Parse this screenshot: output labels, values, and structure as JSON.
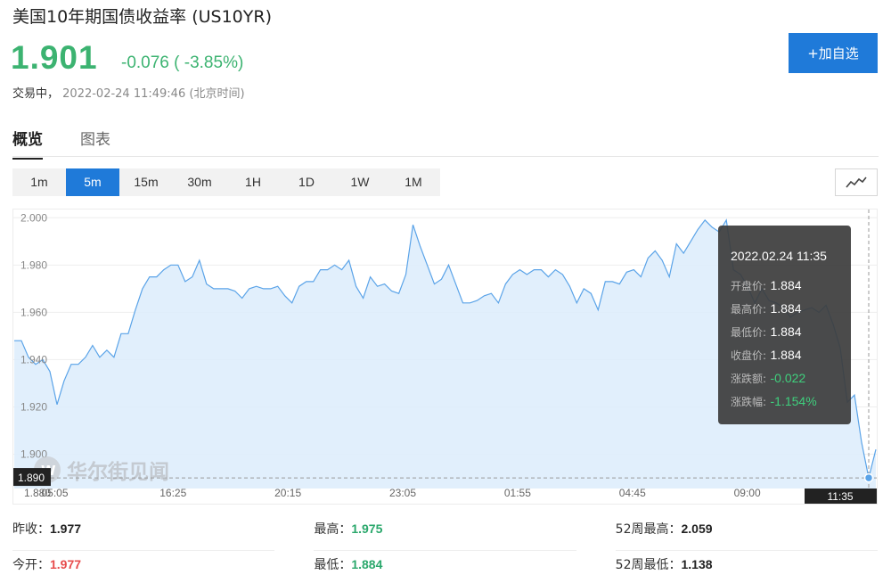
{
  "header": {
    "title": "美国10年期国债收益率 (US10YR)",
    "price": "1.901",
    "change": "-0.076 ( -3.85%)",
    "status": "交易中，",
    "datetime": "2022-02-24 11:49:46",
    "timezone": "(北京时间)",
    "add_button": "+加自选"
  },
  "tabs": [
    {
      "label": "概览",
      "active": true
    },
    {
      "label": "图表",
      "active": false
    }
  ],
  "periods": [
    {
      "label": "1m",
      "active": false
    },
    {
      "label": "5m",
      "active": true
    },
    {
      "label": "15m",
      "active": false
    },
    {
      "label": "30m",
      "active": false
    },
    {
      "label": "1H",
      "active": false
    },
    {
      "label": "1D",
      "active": false
    },
    {
      "label": "1W",
      "active": false
    },
    {
      "label": "1M",
      "active": false
    }
  ],
  "chart_type_icon": "line-chart-icon",
  "chart_data": {
    "type": "area",
    "y_ticks": [
      "2.000",
      "1.980",
      "1.960",
      "1.940",
      "1.920",
      "1.900"
    ],
    "ylim": [
      1.8855,
      2.0035
    ],
    "x_ticks": [
      "05:05",
      "16:25",
      "20:15",
      "23:05",
      "01:55",
      "04:45",
      "09:00"
    ],
    "x_tick_positions": [
      0.048,
      0.185,
      0.318,
      0.451,
      0.584,
      0.717,
      0.85
    ],
    "crosshair_price": "1.890",
    "crosshair_time": "11:35",
    "bottom_left_label": "1.880",
    "values": [
      1.948,
      1.948,
      1.941,
      1.938,
      1.94,
      1.935,
      1.921,
      1.931,
      1.938,
      1.938,
      1.941,
      1.946,
      1.941,
      1.944,
      1.941,
      1.951,
      1.951,
      1.961,
      1.97,
      1.975,
      1.975,
      1.978,
      1.98,
      1.98,
      1.973,
      1.975,
      1.982,
      1.972,
      1.97,
      1.97,
      1.97,
      1.969,
      1.966,
      1.97,
      1.971,
      1.97,
      1.97,
      1.971,
      1.967,
      1.964,
      1.971,
      1.973,
      1.973,
      1.978,
      1.978,
      1.98,
      1.978,
      1.982,
      1.971,
      1.966,
      1.975,
      1.971,
      1.972,
      1.969,
      1.968,
      1.976,
      1.997,
      1.988,
      1.98,
      1.972,
      1.974,
      1.98,
      1.972,
      1.964,
      1.964,
      1.965,
      1.967,
      1.968,
      1.964,
      1.972,
      1.976,
      1.978,
      1.976,
      1.978,
      1.978,
      1.975,
      1.978,
      1.976,
      1.971,
      1.964,
      1.97,
      1.968,
      1.961,
      1.973,
      1.973,
      1.972,
      1.977,
      1.978,
      1.975,
      1.983,
      1.986,
      1.982,
      1.975,
      1.989,
      1.985,
      1.99,
      1.995,
      1.999,
      1.996,
      1.994,
      1.999,
      1.978,
      1.976,
      1.971,
      1.964,
      1.97,
      1.965,
      1.964,
      1.962,
      1.958,
      1.96,
      1.961,
      1.962,
      1.96,
      1.963,
      1.955,
      1.945,
      1.922,
      1.925,
      1.905,
      1.89,
      1.902
    ]
  },
  "tooltip": {
    "date": "2022.02.24 11:35",
    "rows": [
      {
        "label": "开盘价:",
        "value": "1.884",
        "kind": "normal"
      },
      {
        "label": "最高价:",
        "value": "1.884",
        "kind": "normal"
      },
      {
        "label": "最低价:",
        "value": "1.884",
        "kind": "normal"
      },
      {
        "label": "收盘价:",
        "value": "1.884",
        "kind": "normal"
      },
      {
        "label": "涨跌额:",
        "value": "-0.022",
        "kind": "neg"
      },
      {
        "label": "涨跌幅:",
        "value": "-1.154%",
        "kind": "neg"
      }
    ]
  },
  "watermark": "华尔街见闻",
  "stats": {
    "prev_close_label": "昨收：",
    "prev_close": "1.977",
    "high_label": "最高：",
    "high": "1.975",
    "high52_label": "52周最高：",
    "high52": "2.059",
    "open_label": "今开：",
    "open": "1.977",
    "low_label": "最低：",
    "low": "1.884",
    "low52_label": "52周最低：",
    "low52": "1.138"
  },
  "colors": {
    "up": "#e74c4c",
    "down": "#3cb371",
    "accent": "#1f7ad9",
    "line": "#5aa3e8",
    "fill": "#dcecfb"
  }
}
